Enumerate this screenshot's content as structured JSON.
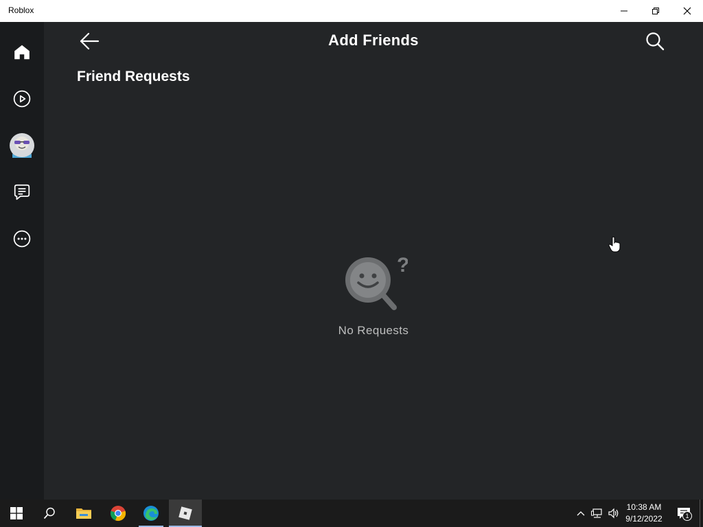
{
  "window": {
    "title": "Roblox"
  },
  "sidebar": {
    "items": [
      {
        "name": "home",
        "icon": "home-icon"
      },
      {
        "name": "discover",
        "icon": "play-circle-icon"
      },
      {
        "name": "avatar",
        "icon": "avatar-icon"
      },
      {
        "name": "chat",
        "icon": "chat-icon"
      },
      {
        "name": "more",
        "icon": "more-icon"
      }
    ]
  },
  "header": {
    "title": "Add Friends"
  },
  "section": {
    "title": "Friend Requests"
  },
  "empty_state": {
    "text": "No Requests",
    "icon": "smiley-magnifier-icon"
  },
  "taskbar": {
    "apps": [
      {
        "name": "start",
        "icon": "windows-icon"
      },
      {
        "name": "search",
        "icon": "search-icon"
      },
      {
        "name": "file-explorer",
        "icon": "folder-icon"
      },
      {
        "name": "chrome",
        "icon": "chrome-icon"
      },
      {
        "name": "edge",
        "icon": "edge-icon"
      },
      {
        "name": "roblox",
        "icon": "roblox-icon"
      }
    ],
    "clock_time": "10:38 AM",
    "clock_date": "9/12/2022",
    "notification_count": "1"
  },
  "colors": {
    "background": "#232527",
    "sidebar": "#191b1d",
    "text": "#ffffff",
    "muted_text": "#bdbebe",
    "taskbar": "#1b1b1b"
  }
}
